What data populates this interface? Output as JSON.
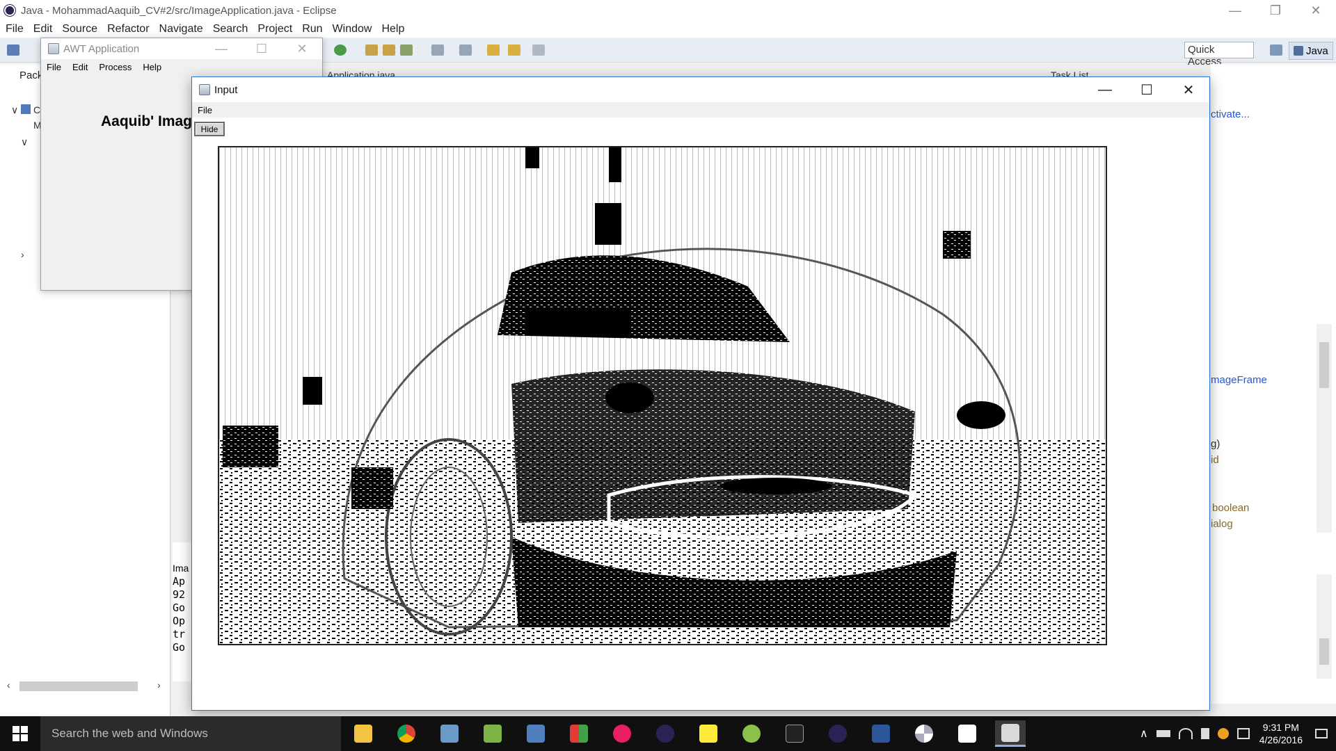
{
  "eclipse": {
    "title": "Java - MohammadAaquib_CV#2/src/ImageApplication.java - Eclipse",
    "menu": [
      "File",
      "Edit",
      "Source",
      "Refactor",
      "Navigate",
      "Search",
      "Project",
      "Run",
      "Window",
      "Help"
    ],
    "quick_access": "Quick Access",
    "perspective": "Java",
    "editor_tab": "Application.java",
    "task_list_tab": "Task List",
    "package_tab": "Packa",
    "tree": [
      "C",
      "M"
    ],
    "console_lines": [
      "Ima",
      "Ap",
      "92",
      "Go",
      "Op",
      "tr",
      "Go"
    ],
    "right_panel": {
      "activate": "ctivate...",
      "outline_items": [
        "mageFrame",
        "g)",
        "id",
        "boolean",
        "ialog"
      ]
    }
  },
  "awt_window": {
    "title": "AWT Application",
    "menu": [
      "File",
      "Edit",
      "Process",
      "Help"
    ],
    "heading": "Aaquib' Image"
  },
  "input_window": {
    "title": "Input",
    "menu": [
      "File"
    ],
    "hide_button": "Hide"
  },
  "taskbar": {
    "search_placeholder": "Search the web and Windows",
    "apps": [
      "file-explorer",
      "chrome",
      "visual-studio",
      "notepad-plus",
      "network-app",
      "office-tiles",
      "flickr",
      "eclipse",
      "sticky-notes",
      "android",
      "cmd",
      "eclipse-2",
      "word",
      "pinwheel",
      "photos",
      "java"
    ],
    "time": "9:31 PM",
    "date": "4/26/2016"
  },
  "colors": {
    "accent_blue": "#2b79d0",
    "toolbar_bg": "#e8edf3",
    "taskbar_bg": "#101010"
  }
}
